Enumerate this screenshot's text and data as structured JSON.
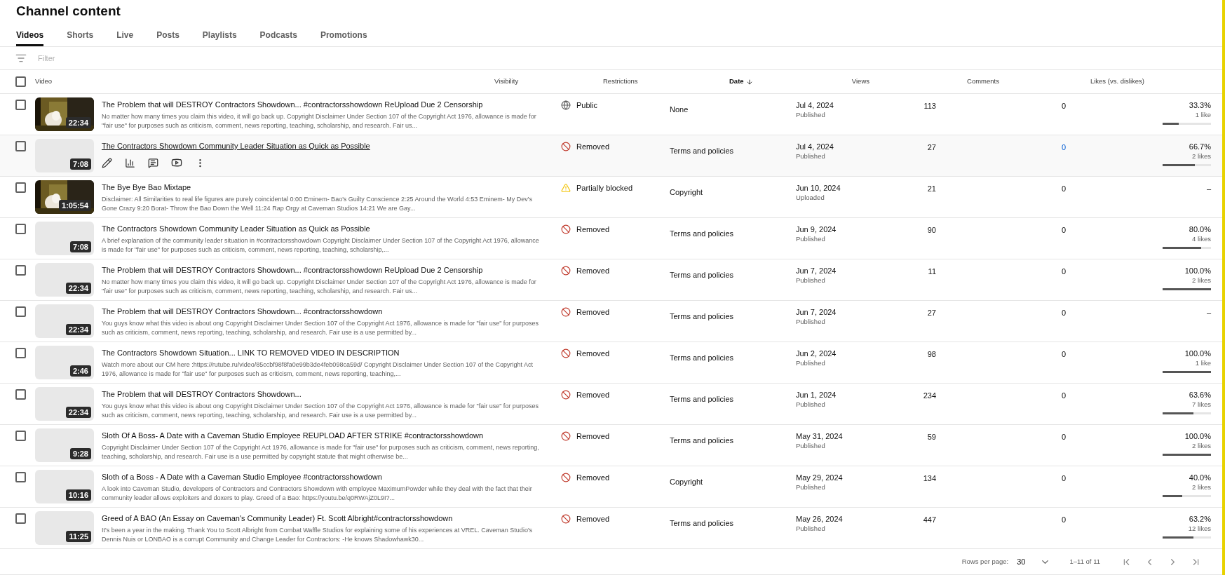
{
  "title": "Channel content",
  "tabs": [
    {
      "label": "Videos",
      "selected": true
    },
    {
      "label": "Shorts",
      "selected": false
    },
    {
      "label": "Live",
      "selected": false
    },
    {
      "label": "Posts",
      "selected": false
    },
    {
      "label": "Playlists",
      "selected": false
    },
    {
      "label": "Podcasts",
      "selected": false
    },
    {
      "label": "Promotions",
      "selected": false
    }
  ],
  "filter": {
    "placeholder": "Filter"
  },
  "select_all": {
    "checked": false
  },
  "columns": [
    {
      "label": "Video",
      "sorted": false
    },
    {
      "label": "Visibility",
      "sorted": false
    },
    {
      "label": "Restrictions",
      "sorted": false
    },
    {
      "label": "Date",
      "sorted": true
    },
    {
      "label": "Views",
      "sorted": false
    },
    {
      "label": "Comments",
      "sorted": false
    },
    {
      "label": "Likes (vs. dislikes)",
      "sorted": false
    }
  ],
  "rows": [
    {
      "checked": false,
      "hovered": false,
      "thumbnail": {
        "kind": "picture",
        "duration": "22:34"
      },
      "title": "The Problem that will DESTROY Contractors Showdown... #contractorsshowdown ReUpload Due 2 Censorship",
      "description": "No matter how many times you claim this video, it will go back up. Copyright Disclaimer Under Section 107 of the Copyright Act 1976, allowance is made for \"fair use\" for purposes such as criticism, comment, news reporting, teaching, scholarship, and research. Fair us...",
      "visibility": {
        "kind": "public",
        "label": "Public"
      },
      "restrictions": "None",
      "date": "Jul 4, 2024",
      "date_status": "Published",
      "views": "113",
      "comments": "0",
      "likes": {
        "percent": "33.3%",
        "count": "1 like",
        "level": 0.333
      }
    },
    {
      "checked": false,
      "hovered": true,
      "thumbnail": {
        "kind": "placeholder",
        "duration": "7:08"
      },
      "title": "The Contractors Showdown Community Leader Situation as Quick as Possible",
      "visibility": {
        "kind": "removed",
        "label": "Removed"
      },
      "restrictions": "Terms and policies",
      "date": "Jul 4, 2024",
      "date_status": "Published",
      "views": "27",
      "comments": "0",
      "likes": {
        "percent": "66.7%",
        "count": "2 likes",
        "level": 0.667
      }
    },
    {
      "checked": false,
      "hovered": false,
      "thumbnail": {
        "kind": "picture",
        "duration": "1:05:54"
      },
      "title": "The Bye Bye Bao Mixtape",
      "description": "Disclaimer: All Similarities to real life figures are purely coincidental 0:00 Eminem- Bao's Guilty Conscience 2:25 Around the World 4:53 Eminem- My Dev's Gone Crazy 9:20 Borat- Throw the Bao Down the Well 11:24 Rap Orgy at Caveman Studios 14:21 We are Gay...",
      "visibility": {
        "kind": "partial",
        "label": "Partially blocked"
      },
      "restrictions": "Copyright",
      "date": "Jun 10, 2024",
      "date_status": "Uploaded",
      "views": "21",
      "comments": "0",
      "likes_text": "–"
    },
    {
      "checked": false,
      "hovered": false,
      "thumbnail": {
        "kind": "placeholder",
        "duration": "7:08"
      },
      "title": "The Contractors Showdown Community Leader Situation as Quick as Possible",
      "description": "A brief explanation of the community leader situation in #contractorsshowdown Copyright Disclaimer Under Section 107 of the Copyright Act 1976, allowance is made for \"fair use\" for purposes such as criticism, comment, news reporting, teaching, scholarship,...",
      "visibility": {
        "kind": "removed",
        "label": "Removed"
      },
      "restrictions": "Terms and policies",
      "date": "Jun 9, 2024",
      "date_status": "Published",
      "views": "90",
      "comments": "0",
      "likes": {
        "percent": "80.0%",
        "count": "4 likes",
        "level": 0.8
      }
    },
    {
      "checked": false,
      "hovered": false,
      "thumbnail": {
        "kind": "placeholder",
        "duration": "22:34"
      },
      "title": "The Problem that will DESTROY Contractors Showdown... #contractorsshowdown ReUpload Due 2 Censorship",
      "description": "No matter how many times you claim this video, it will go back up. Copyright Disclaimer Under Section 107 of the Copyright Act 1976, allowance is made for \"fair use\" for purposes such as criticism, comment, news reporting, teaching, scholarship, and research. Fair us...",
      "visibility": {
        "kind": "removed",
        "label": "Removed"
      },
      "restrictions": "Terms and policies",
      "date": "Jun 7, 2024",
      "date_status": "Published",
      "views": "11",
      "comments": "0",
      "likes": {
        "percent": "100.0%",
        "count": "2 likes",
        "level": 1
      }
    },
    {
      "checked": false,
      "hovered": false,
      "thumbnail": {
        "kind": "placeholder",
        "duration": "22:34"
      },
      "title": "The Problem that will DESTROY Contractors Showdown... #contractorsshowdown",
      "description": "You guys know what this video is about ong Copyright Disclaimer Under Section 107 of the Copyright Act 1976, allowance is made for \"fair use\" for purposes such as criticism, comment, news reporting, teaching, scholarship, and research. Fair use is a use permitted by...",
      "visibility": {
        "kind": "removed",
        "label": "Removed"
      },
      "restrictions": "Terms and policies",
      "date": "Jun 7, 2024",
      "date_status": "Published",
      "views": "27",
      "comments": "0",
      "likes_text": "–"
    },
    {
      "checked": false,
      "hovered": false,
      "thumbnail": {
        "kind": "placeholder",
        "duration": "2:46"
      },
      "title": "The Contractors Showdown Situation... LINK TO REMOVED VIDEO IN DESCRIPTION",
      "description": "Watch more about our CM here :https://rutube.ru/video/85ccbf98f8fa0e99b3de4feb098ca59d/ Copyright Disclaimer Under Section 107 of the Copyright Act 1976, allowance is made for \"fair use\" for purposes such as criticism, comment, news reporting, teaching,...",
      "visibility": {
        "kind": "removed",
        "label": "Removed"
      },
      "restrictions": "Terms and policies",
      "date": "Jun 2, 2024",
      "date_status": "Published",
      "views": "98",
      "comments": "0",
      "likes": {
        "percent": "100.0%",
        "count": "1 like",
        "level": 1
      }
    },
    {
      "checked": false,
      "hovered": false,
      "thumbnail": {
        "kind": "placeholder",
        "duration": "22:34"
      },
      "title": "The Problem that will DESTROY Contractors Showdown...",
      "description": "You guys know what this video is about ong Copyright Disclaimer Under Section 107 of the Copyright Act 1976, allowance is made for \"fair use\" for purposes such as criticism, comment, news reporting, teaching, scholarship, and research. Fair use is a use permitted by...",
      "visibility": {
        "kind": "removed",
        "label": "Removed"
      },
      "restrictions": "Terms and policies",
      "date": "Jun 1, 2024",
      "date_status": "Published",
      "views": "234",
      "comments": "0",
      "likes": {
        "percent": "63.6%",
        "count": "7 likes",
        "level": 0.636
      }
    },
    {
      "checked": false,
      "hovered": false,
      "thumbnail": {
        "kind": "placeholder",
        "duration": "9:28"
      },
      "title": "Sloth Of A Boss- A Date with a Caveman Studio Employee REUPLOAD AFTER STRIKE #contractorsshowdown",
      "description": "Copyright Disclaimer Under Section 107 of the Copyright Act 1976, allowance is made for \"fair use\" for purposes such as criticism, comment, news reporting, teaching, scholarship, and research. Fair use is a use permitted by copyright statute that might otherwise be...",
      "visibility": {
        "kind": "removed",
        "label": "Removed"
      },
      "restrictions": "Terms and policies",
      "date": "May 31, 2024",
      "date_status": "Published",
      "views": "59",
      "comments": "0",
      "likes": {
        "percent": "100.0%",
        "count": "2 likes",
        "level": 1
      }
    },
    {
      "checked": false,
      "hovered": false,
      "thumbnail": {
        "kind": "placeholder",
        "duration": "10:16"
      },
      "title": "Sloth of a Boss - A Date with a Caveman Studio Employee #contractorsshowdown",
      "description": "A look into Caveman Studio, developers of Contractors and Contractors Showdown with employee MaximumPowder while they deal with the fact that their community leader allows exploiters and doxers to play. Greed of a Bao: https://youtu.be/q0RWAjZ0L9I?...",
      "visibility": {
        "kind": "removed",
        "label": "Removed"
      },
      "restrictions": "Copyright",
      "date": "May 29, 2024",
      "date_status": "Published",
      "views": "134",
      "comments": "0",
      "likes": {
        "percent": "40.0%",
        "count": "2 likes",
        "level": 0.4
      }
    },
    {
      "checked": false,
      "hovered": false,
      "thumbnail": {
        "kind": "placeholder",
        "duration": "11:25"
      },
      "title": "Greed of A BAO (An Essay on Caveman's Community Leader) Ft. Scott Albright#contractorsshowdown",
      "description": "It's been a year in the making. Thank You to Scott Albright from Combat Waffle Studios for explaining some of his experiences at VREL. Caveman Studio's Dennis Nuis or LONBAO is a corrupt Community and Change Leader for Contractors: -He knows Shadowhawk30...",
      "visibility": {
        "kind": "removed",
        "label": "Removed"
      },
      "restrictions": "Terms and policies",
      "date": "May 26, 2024",
      "date_status": "Published",
      "views": "447",
      "comments": "0",
      "likes": {
        "percent": "63.2%",
        "count": "12 likes",
        "level": 0.632
      }
    }
  ],
  "pagination": {
    "rows_per_page_label": "Rows per page:",
    "rows_per_page": "30",
    "range": "1–11 of 11"
  }
}
